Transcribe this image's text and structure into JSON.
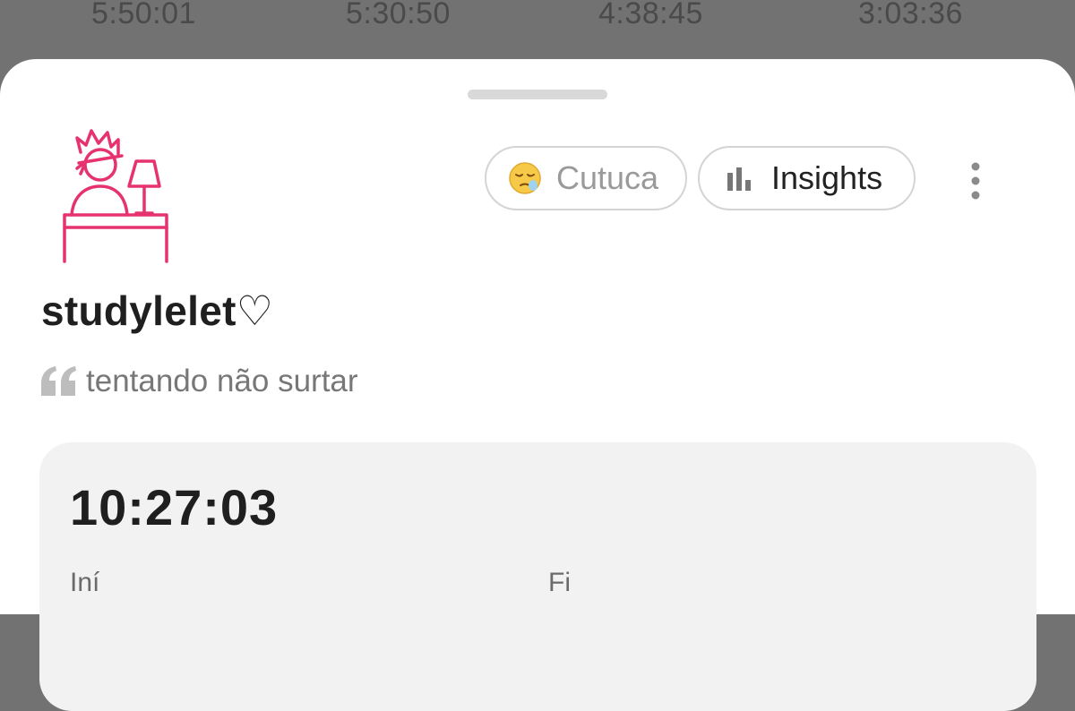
{
  "background_timers": [
    "5:50:01",
    "5:30:50",
    "4:38:45",
    "3:03:36"
  ],
  "profile": {
    "username": "studylelet♡",
    "status": "tentando não surtar",
    "avatar_icon": "student-studying-desk-icon",
    "accent_color": "#e6336f"
  },
  "actions": {
    "cutuca_label": "Cutuca",
    "cutuca_icon": "sleepy-face-emoji",
    "insights_label": "Insights",
    "insights_icon": "bar-chart-icon",
    "more_icon": "more-vertical-icon"
  },
  "card": {
    "total_time": "10:27:03",
    "start_label": "Iní",
    "end_label": "Fi"
  }
}
